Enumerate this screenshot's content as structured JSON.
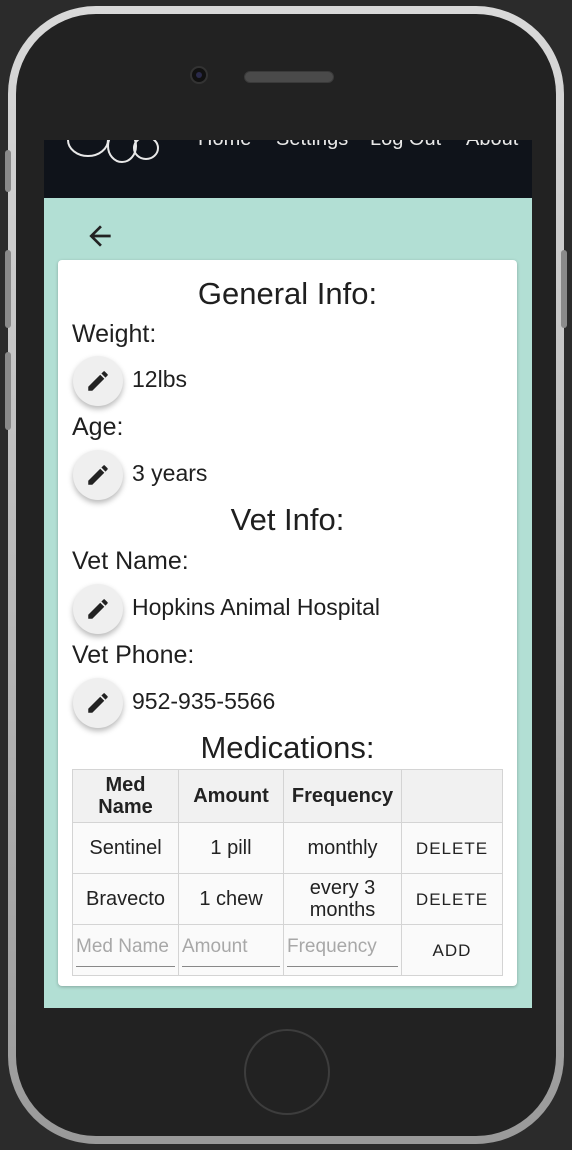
{
  "nav": {
    "links": [
      "Home",
      "Settings",
      "Log Out",
      "About"
    ]
  },
  "general": {
    "title": "General Info:",
    "weight_label": "Weight:",
    "weight_value": "12lbs",
    "age_label": "Age:",
    "age_value": "3 years"
  },
  "vet": {
    "title": "Vet Info:",
    "name_label": "Vet Name:",
    "name_value": "Hopkins Animal Hospital",
    "phone_label": "Vet Phone:",
    "phone_value": "952-935-5566"
  },
  "meds": {
    "title": "Medications:",
    "headers": [
      "Med Name",
      "Amount",
      "Frequency",
      ""
    ],
    "rows": [
      {
        "name": "Sentinel",
        "amount": "1 pill",
        "frequency": "monthly",
        "action": "DELETE"
      },
      {
        "name": "Bravecto",
        "amount": "1 chew",
        "frequency": "every 3 months",
        "action": "DELETE"
      }
    ],
    "new_row": {
      "name_placeholder": "Med Name",
      "amount_placeholder": "Amount",
      "frequency_placeholder": "Frequency",
      "add_label": "ADD"
    }
  },
  "colors": {
    "background": "#b2dfd4",
    "navbar": "#0f131a"
  }
}
